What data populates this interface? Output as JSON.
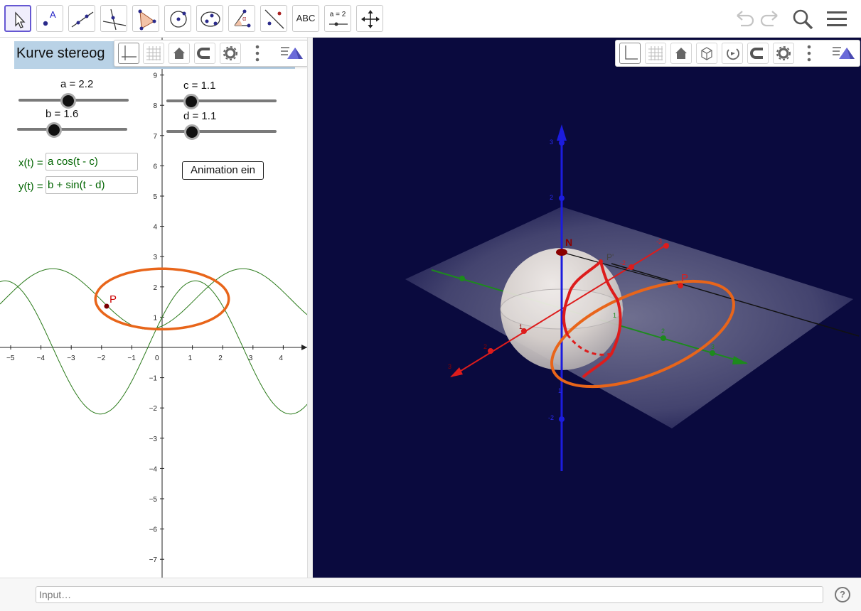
{
  "toolbar": {
    "tools": [
      {
        "name": "move-tool",
        "icon": "cursor-arrow-icon"
      },
      {
        "name": "point-tool",
        "icon": "point-icon",
        "text": "A"
      },
      {
        "name": "line-tool",
        "icon": "line-icon"
      },
      {
        "name": "perpendicular-line-tool",
        "icon": "perpendicular-icon"
      },
      {
        "name": "polygon-tool",
        "icon": "polygon-icon"
      },
      {
        "name": "circle-center-point-tool",
        "icon": "circle-icon"
      },
      {
        "name": "conic-tool",
        "icon": "ellipse-icon"
      },
      {
        "name": "angle-tool",
        "icon": "angle-icon",
        "text": "α"
      },
      {
        "name": "reflect-tool",
        "icon": "reflect-icon"
      },
      {
        "name": "text-tool",
        "icon": "text-icon",
        "text": "ABC"
      },
      {
        "name": "slider-tool",
        "icon": "slider-icon",
        "text": "a = 2"
      },
      {
        "name": "move-graphics-tool",
        "icon": "move-arrows-icon"
      }
    ],
    "undo_icon": "undo-icon",
    "redo_icon": "redo-icon",
    "search_icon": "search-icon",
    "menu_icon": "hamburger-menu-icon"
  },
  "algebra": {
    "title": "Kurve stereog",
    "sliders": [
      {
        "label": "a = 2.2",
        "value": 2.2
      },
      {
        "label": "b = 1.6",
        "value": 1.6
      },
      {
        "label": "c = 1.1",
        "value": 1.1
      },
      {
        "label": "d = 1.1",
        "value": 1.1
      }
    ],
    "functions": [
      {
        "label": "x(t) =",
        "value": "a cos(t - c)"
      },
      {
        "label": "y(t) =",
        "value": "b + sin(t - d)"
      }
    ],
    "animation_button": "Animation ein"
  },
  "graph2d": {
    "x_ticks": [
      "−5",
      "−4",
      "−3",
      "−2",
      "−1",
      "0",
      "1",
      "2",
      "3",
      "4"
    ],
    "y_ticks": [
      "9",
      "8",
      "7",
      "6",
      "5",
      "4",
      "3",
      "2",
      "1",
      "−1",
      "−2",
      "−3",
      "−4",
      "−5",
      "−6",
      "−7"
    ],
    "point_label": "P",
    "curve_color": "#e8651a",
    "sine_color": "#2a7a1a",
    "point_color": "#cc0000"
  },
  "view3d": {
    "background_color": "#0a0a3e",
    "labels": {
      "north": "N",
      "point": "P",
      "projected": "P'",
      "z_ticks": [
        "3",
        "2",
        "1",
        "-2"
      ],
      "y_ticks": [
        "-3",
        "-2",
        "1",
        "2",
        "3"
      ],
      "x_ticks": [
        "1",
        "2",
        "3"
      ]
    }
  },
  "stylebar2d": {
    "icons": [
      "axes-icon",
      "grid-icon",
      "home-icon",
      "point-capture-icon",
      "settings-icon",
      "more-icon",
      "view-menu-icon"
    ]
  },
  "stylebar3d": {
    "icons": [
      "axes-icon",
      "grid-icon",
      "home-icon",
      "cube-icon",
      "rotate-icon",
      "point-capture-icon",
      "settings-icon",
      "more-icon",
      "view-menu-icon"
    ]
  },
  "input": {
    "placeholder": "Input…",
    "help_label": "?"
  }
}
